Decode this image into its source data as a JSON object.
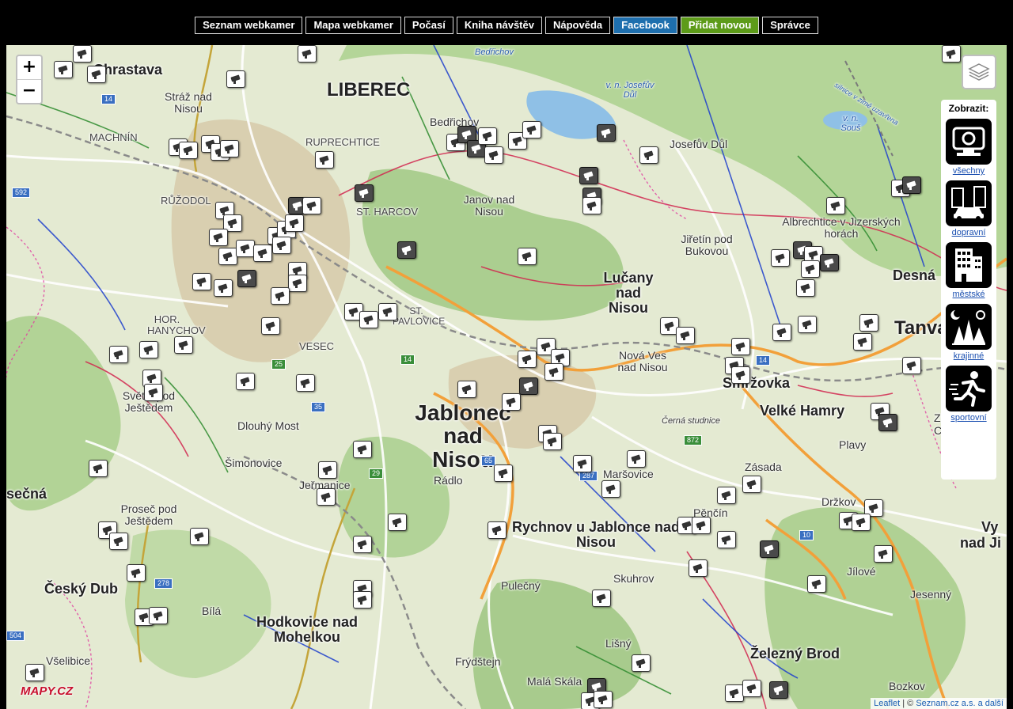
{
  "nav": {
    "items": [
      {
        "label": "Seznam webkamer"
      },
      {
        "label": "Mapa webkamer"
      },
      {
        "label": "Počasí"
      },
      {
        "label": "Kniha návštěv"
      },
      {
        "label": "Nápověda"
      },
      {
        "label": "Facebook"
      },
      {
        "label": "Přidat novou"
      },
      {
        "label": "Správce"
      }
    ]
  },
  "map": {
    "zoom_in": "+",
    "zoom_out": "−",
    "logo": "MAPY.CZ",
    "attribution": {
      "leaflet": "Leaflet",
      "sep": " | © ",
      "seznam": "Seznam.cz a.s. a další"
    },
    "places": [
      {
        "name": "Chrastava"
      },
      {
        "name": "Stráž nad Nisou"
      },
      {
        "name": "LIBEREC"
      },
      {
        "name": "Bedřichov"
      },
      {
        "name": "MACHNÍN"
      },
      {
        "name": "RUPRECHTICE"
      },
      {
        "name": "RŮŽODOL"
      },
      {
        "name": "ST. HARCOV"
      },
      {
        "name": "Janov nad Nisou"
      },
      {
        "name": "Josefův Důl"
      },
      {
        "name": "Albrechtice v Jizerských horách"
      },
      {
        "name": "Jiřetín pod Bukovou"
      },
      {
        "name": "Lučany nad Nisou"
      },
      {
        "name": "Desná"
      },
      {
        "name": "Tanvald"
      },
      {
        "name": "HOR. HANYCHOV"
      },
      {
        "name": "VESEC"
      },
      {
        "name": "Světlá pod Ještědem"
      },
      {
        "name": "Nová Ves nad Nisou"
      },
      {
        "name": "Smržovka"
      },
      {
        "name": "Jablonec nad Nisou"
      },
      {
        "name": "Velké Hamry"
      },
      {
        "name": "Dlouhý Most"
      },
      {
        "name": "Šimonovice"
      },
      {
        "name": "Plavy"
      },
      {
        "name": "Zásada"
      },
      {
        "name": "Jeřmanice"
      },
      {
        "name": "Rádlo"
      },
      {
        "name": "Maršovice"
      },
      {
        "name": "Pěnčín"
      },
      {
        "name": "Držkov"
      },
      {
        "name": "Proseč pod Ještědem"
      },
      {
        "name": "Rychnov u Jablonce nad Nisou"
      },
      {
        "name": "Český Dub"
      },
      {
        "name": "Pulečný"
      },
      {
        "name": "Skuhrov"
      },
      {
        "name": "Jílové"
      },
      {
        "name": "Jesenný"
      },
      {
        "name": "Bílá"
      },
      {
        "name": "Hodkovice nad Mohelkou"
      },
      {
        "name": "Lišný"
      },
      {
        "name": "Železný Brod"
      },
      {
        "name": "Všelibice"
      },
      {
        "name": "Frýdštejn"
      },
      {
        "name": "Malá Skála"
      },
      {
        "name": "Bozkov"
      },
      {
        "name": "sečná"
      },
      {
        "name": "Zla"
      },
      {
        "name": "Ché"
      },
      {
        "name": "Vy"
      },
      {
        "name": "nad Ji"
      },
      {
        "name": "ST. PAVLOVICE"
      }
    ],
    "water_labels": [
      {
        "name": "Bedřichov"
      },
      {
        "name": "v. n. Josefův Důl"
      },
      {
        "name": "v. n. Souš"
      },
      {
        "name": "silnice v zimě uzavřena"
      },
      {
        "name": "Černá studnice"
      }
    ],
    "road_numbers": [
      "14",
      "592",
      "35",
      "25",
      "65",
      "287",
      "10",
      "278",
      "29",
      "14",
      "14",
      "504",
      "872"
    ]
  },
  "filter": {
    "title": "Zobrazit:",
    "items": [
      {
        "label": "všechny",
        "icon": "camera-icon"
      },
      {
        "label": "dopravní",
        "icon": "traffic-icon"
      },
      {
        "label": "městské",
        "icon": "city-icon"
      },
      {
        "label": "krajinné",
        "icon": "landscape-icon"
      },
      {
        "label": "sportovní",
        "icon": "sport-icon"
      }
    ]
  }
}
